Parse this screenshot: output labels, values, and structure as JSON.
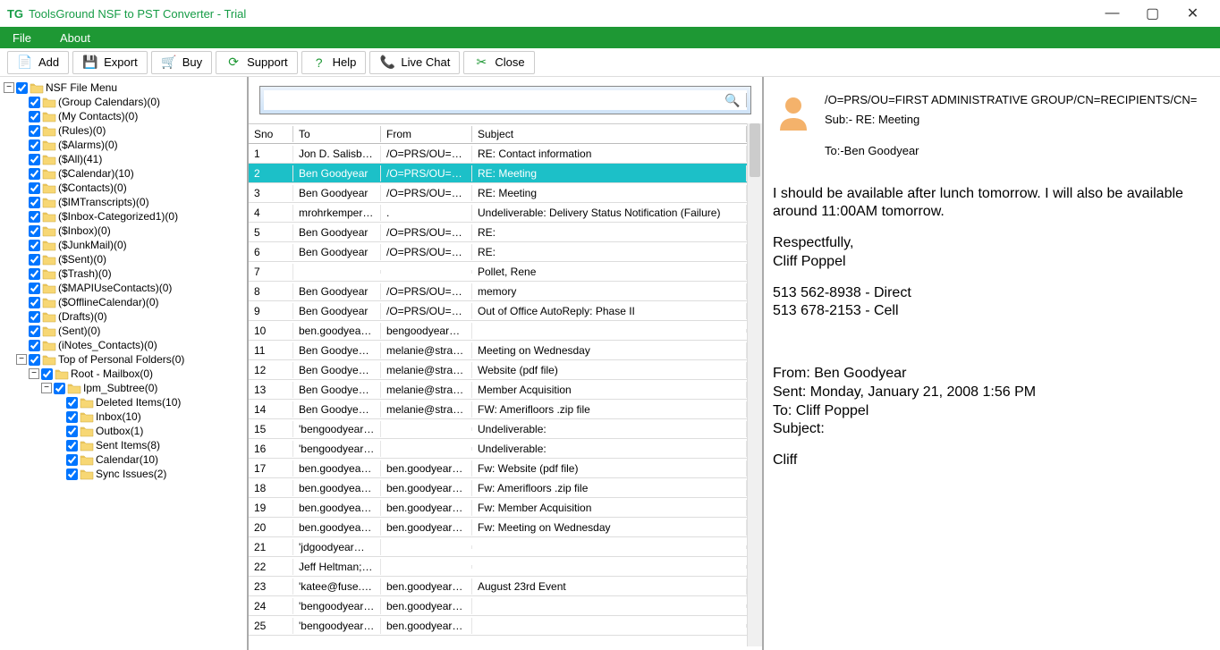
{
  "window": {
    "title": "ToolsGround NSF to PST Converter - Trial",
    "icon": "TG"
  },
  "menubar": {
    "file": "File",
    "about": "About"
  },
  "toolbar": {
    "add": "Add",
    "export": "Export",
    "buy": "Buy",
    "support": "Support",
    "help": "Help",
    "livechat": "Live Chat",
    "close": "Close"
  },
  "tree": [
    {
      "lvl": 0,
      "exp": "−",
      "label": "NSF File Menu"
    },
    {
      "lvl": 1,
      "label": "(Group Calendars)(0)"
    },
    {
      "lvl": 1,
      "label": "(My Contacts)(0)"
    },
    {
      "lvl": 1,
      "label": "(Rules)(0)"
    },
    {
      "lvl": 1,
      "label": "($Alarms)(0)"
    },
    {
      "lvl": 1,
      "label": "($All)(41)"
    },
    {
      "lvl": 1,
      "label": "($Calendar)(10)"
    },
    {
      "lvl": 1,
      "label": "($Contacts)(0)"
    },
    {
      "lvl": 1,
      "label": "($IMTranscripts)(0)"
    },
    {
      "lvl": 1,
      "label": "($Inbox-Categorized1)(0)"
    },
    {
      "lvl": 1,
      "label": "($Inbox)(0)"
    },
    {
      "lvl": 1,
      "label": "($JunkMail)(0)"
    },
    {
      "lvl": 1,
      "label": "($Sent)(0)"
    },
    {
      "lvl": 1,
      "label": "($Trash)(0)"
    },
    {
      "lvl": 1,
      "label": "($MAPIUseContacts)(0)"
    },
    {
      "lvl": 1,
      "label": "($OfflineCalendar)(0)"
    },
    {
      "lvl": 1,
      "label": "(Drafts)(0)"
    },
    {
      "lvl": 1,
      "label": "(Sent)(0)"
    },
    {
      "lvl": 1,
      "label": "(iNotes_Contacts)(0)"
    },
    {
      "lvl": 1,
      "exp": "−",
      "label": "Top of Personal Folders(0)"
    },
    {
      "lvl": 2,
      "exp": "−",
      "label": "Root - Mailbox(0)"
    },
    {
      "lvl": 3,
      "exp": "−",
      "label": "Ipm_Subtree(0)"
    },
    {
      "lvl": 4,
      "label": "Deleted Items(10)"
    },
    {
      "lvl": 4,
      "label": "Inbox(10)"
    },
    {
      "lvl": 4,
      "label": "Outbox(1)"
    },
    {
      "lvl": 4,
      "label": "Sent Items(8)"
    },
    {
      "lvl": 4,
      "label": "Calendar(10)"
    },
    {
      "lvl": 4,
      "label": "Sync Issues(2)"
    }
  ],
  "table": {
    "cols": {
      "sno": "Sno",
      "to": "To",
      "from": "From",
      "subject": "Subject"
    },
    "rows": [
      {
        "sno": "1",
        "to": "Jon D. Salisbury; ...",
        "from": "/O=PRS/OU=FI...",
        "subject": "RE: Contact information"
      },
      {
        "sno": "2",
        "to": "Ben Goodyear",
        "from": "/O=PRS/OU=FI...",
        "subject": "RE: Meeting",
        "selected": true
      },
      {
        "sno": "3",
        "to": "Ben Goodyear",
        "from": "/O=PRS/OU=FI...",
        "subject": "RE: Meeting"
      },
      {
        "sno": "4",
        "to": "mrohrkemper@ci...",
        "from": ".",
        "subject": "Undeliverable: Delivery Status Notification (Failure)"
      },
      {
        "sno": "5",
        "to": "Ben Goodyear",
        "from": "/O=PRS/OU=FI...",
        "subject": "RE:"
      },
      {
        "sno": "6",
        "to": "Ben Goodyear",
        "from": "/O=PRS/OU=FI...",
        "subject": "RE:"
      },
      {
        "sno": "7",
        "to": "",
        "from": "",
        "subject": "Pollet, Rene"
      },
      {
        "sno": "8",
        "to": "Ben Goodyear",
        "from": "/O=PRS/OU=FI...",
        "subject": "memory"
      },
      {
        "sno": "9",
        "to": "Ben Goodyear",
        "from": "/O=PRS/OU=FI...",
        "subject": "Out of Office AutoReply: Phase II"
      },
      {
        "sno": "10",
        "to": "ben.goodyear@s...",
        "from": "bengoodyear@h...",
        "subject": ""
      },
      {
        "sno": "11",
        "to": "Ben Goodyear; b...",
        "from": "melanie@strata-g...",
        "subject": "Meeting on Wednesday"
      },
      {
        "sno": "12",
        "to": "Ben Goodyear; b...",
        "from": "melanie@strata-g...",
        "subject": "Website (pdf file)"
      },
      {
        "sno": "13",
        "to": "Ben Goodyear; b...",
        "from": "melanie@strata-g...",
        "subject": "Member Acquisition"
      },
      {
        "sno": "14",
        "to": "Ben Goodyear; b...",
        "from": "melanie@strata-g...",
        "subject": "FW: Amerifloors .zip file"
      },
      {
        "sno": "15",
        "to": "'bengoodyear@h...",
        "from": "",
        "subject": "Undeliverable:"
      },
      {
        "sno": "16",
        "to": "'bengoodyear@h...",
        "from": "",
        "subject": "Undeliverable:"
      },
      {
        "sno": "17",
        "to": "ben.goodyear@s...",
        "from": "ben.goodyear@s...",
        "subject": "Fw: Website (pdf file)"
      },
      {
        "sno": "18",
        "to": "ben.goodyear@s...",
        "from": "ben.goodyear@s...",
        "subject": "Fw: Amerifloors .zip file"
      },
      {
        "sno": "19",
        "to": "ben.goodyear@s...",
        "from": "ben.goodyear@s...",
        "subject": "Fw: Member Acquisition"
      },
      {
        "sno": "20",
        "to": "ben.goodyear@s...",
        "from": "ben.goodyear@s...",
        "subject": "Fw: Meeting on Wednesday"
      },
      {
        "sno": "21",
        "to": "'jdgoodyear@yah...",
        "from": "",
        "subject": ""
      },
      {
        "sno": "22",
        "to": "Jeff Heltman; Gol...",
        "from": "",
        "subject": ""
      },
      {
        "sno": "23",
        "to": "'katee@fuse.net'",
        "from": "ben.goodyear@s...",
        "subject": "August 23rd Event"
      },
      {
        "sno": "24",
        "to": "'bengoodyear@h...",
        "from": "ben.goodyear@s...",
        "subject": ""
      },
      {
        "sno": "25",
        "to": "'bengoodyear@h...",
        "from": "ben.goodyear@s...",
        "subject": ""
      }
    ]
  },
  "preview": {
    "from": "/O=PRS/OU=FIRST ADMINISTRATIVE GROUP/CN=RECIPIENTS/CN=",
    "subject": "Sub:- RE: Meeting",
    "to": "To:-Ben Goodyear",
    "body_lines": [
      "I should be available after lunch tomorrow.  I will also be available around 11:00AM tomorrow.",
      "",
      "Respectfully,",
      "Cliff Poppel",
      "",
      "513 562-8938 - Direct",
      "513 678-2153 - Cell",
      "",
      "",
      "From: Ben Goodyear",
      "Sent: Monday, January 21, 2008 1:56 PM",
      "To: Cliff Poppel",
      "Subject:",
      "",
      "Cliff"
    ]
  }
}
